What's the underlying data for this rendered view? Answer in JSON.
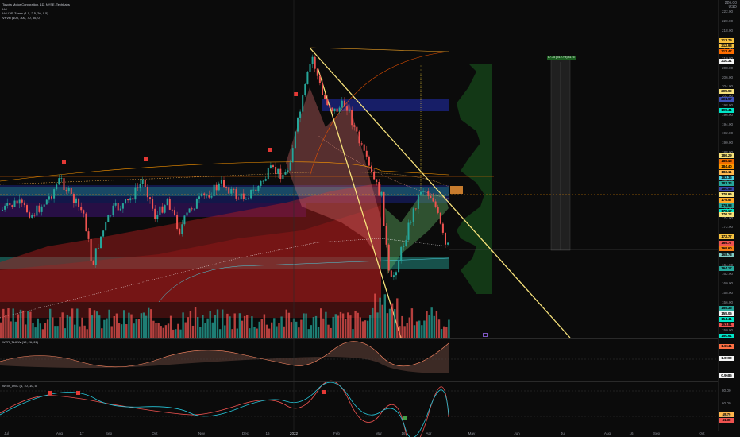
{
  "legend": {
    "title": "Toyota Motor Corporation, 1D, NYSE, TechLabs",
    "line2": "Vol",
    "line3": "Vol LVB Zones (1.5, 2.5, 20, 0.5)",
    "line4": "VPVR (100, 300, 70, 50, 0)"
  },
  "unit": {
    "currency": "USD",
    "top": "226.00"
  },
  "price_ticks": [
    "222.00",
    "220.00",
    "218.00",
    "216.00",
    "212.00",
    "210.00",
    "208.00",
    "206.00",
    "204.00",
    "202.00",
    "198.00",
    "196.00",
    "194.00",
    "192.00",
    "190.00",
    "188.00",
    "186.00",
    "184.00",
    "182.00",
    "180.00",
    "178.00",
    "176.00",
    "174.00",
    "172.00",
    "170.00",
    "168.00",
    "166.00",
    "164.00",
    "162.00",
    "160.00",
    "158.00",
    "156.00",
    "154.00",
    "152.00",
    "150.00"
  ],
  "price_tags": [
    {
      "text": "213.79",
      "color": "#f7c23f"
    },
    {
      "text": "212.98",
      "color": "#f7c23f"
    },
    {
      "text": "212.47",
      "color": "#ff6d00"
    },
    {
      "text": "210.31",
      "color": "#f5f5f5"
    },
    {
      "text": "205.99",
      "color": "#f7e27b"
    },
    {
      "text": "201.97",
      "color": "#3f51b5"
    },
    {
      "text": "199.41",
      "color": "#00e5c8"
    },
    {
      "text": "186.29",
      "color": "#f7e27b"
    },
    {
      "text": "185.46",
      "color": "#ef6c00"
    },
    {
      "text": "184.40",
      "color": "#ff9800"
    },
    {
      "text": "183.11",
      "color": "#ffb74d"
    },
    {
      "text": "182.36",
      "color": "#4dd0e1"
    },
    {
      "text": "181.34",
      "color": "#26a69a"
    },
    {
      "text": "180.55",
      "color": "#3949ab"
    },
    {
      "text": "179.96",
      "color": "#f7e27b"
    },
    {
      "text": "179.57",
      "color": "#ffa726"
    },
    {
      "text": "178.98",
      "color": "#26a69a"
    },
    {
      "text": "178.17",
      "color": "#00e5c8"
    },
    {
      "text": "176.12",
      "color": "#f7e27b"
    },
    {
      "text": "172.77",
      "color": "#f7c23f"
    },
    {
      "text": "169.77",
      "color": "#ef5350"
    },
    {
      "text": "169.60",
      "color": "#f57f17"
    },
    {
      "text": "168.78",
      "color": "#80cbc4"
    },
    {
      "text": "164.17",
      "color": "#26a69a"
    },
    {
      "text": "155.36",
      "color": "#26a69a"
    },
    {
      "text": "155.05",
      "color": "#f5f5f5"
    },
    {
      "text": "154.41",
      "color": "#00e5c8"
    },
    {
      "text": "153.81",
      "color": "#ef5350"
    },
    {
      "text": "150.61",
      "color": "#00e5c8"
    }
  ],
  "time_ticks": [
    "Jul",
    "Aug",
    "17",
    "Sep",
    "Oct",
    "Nov",
    "Dec",
    "16",
    "2022",
    "Feb",
    "Mar",
    "16",
    "Apr",
    "May",
    "Jun",
    "Jul",
    "Aug",
    "16",
    "Sep",
    "Oct"
  ],
  "boxes": {
    "target_label": "87.75 (24.77%) 4175"
  },
  "panes": {
    "osc1": {
      "label": "WTR_TLIEW (12, 26, 26)",
      "tags": [
        "1.6541",
        "1.0000",
        "0.9685"
      ]
    },
    "osc2": {
      "label": "WTM_OSC (4, 10, 10, 5)",
      "ticks": [
        "80.00",
        "60.00",
        "40.00"
      ],
      "tags": [
        "48.70",
        "41.38"
      ]
    }
  },
  "colors": {
    "up": "#26a69a",
    "down": "#ef5350",
    "trend": "#f7e27b",
    "box_blue": "#1a237e",
    "box_teal": "#00897b"
  }
}
